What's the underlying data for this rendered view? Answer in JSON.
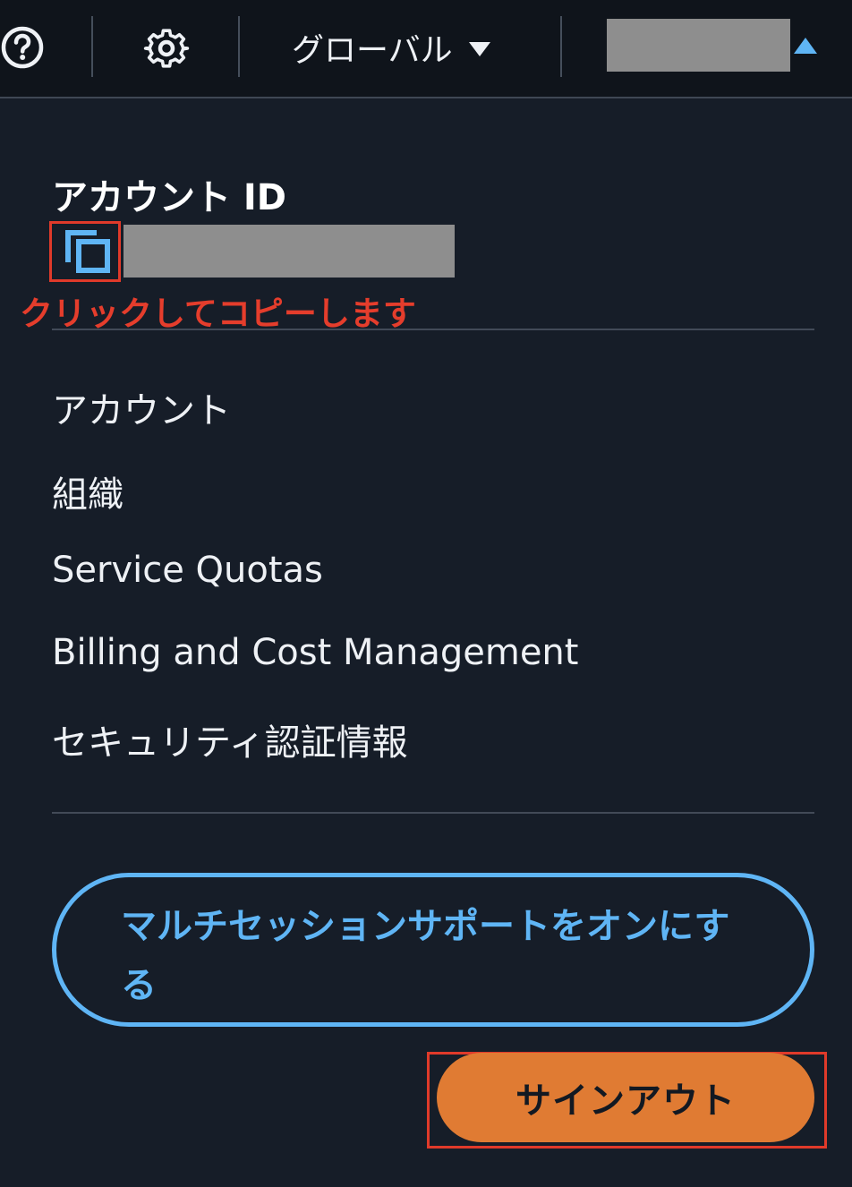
{
  "topbar": {
    "help_icon": "help-circle-icon",
    "settings_icon": "gear-icon",
    "region_label": "グローバル",
    "account_name_redacted": true,
    "account_menu_state": "open"
  },
  "account": {
    "id_label": "アカウント ID",
    "copy_icon": "copy-icon",
    "id_value_redacted": true,
    "copy_annotation": "クリックしてコピーします"
  },
  "menu": {
    "items": [
      {
        "label": "アカウント"
      },
      {
        "label": "組織"
      },
      {
        "label": "Service Quotas"
      },
      {
        "label": "Billing and Cost Management"
      },
      {
        "label": "セキュリティ認証情報"
      }
    ]
  },
  "actions": {
    "multi_session_label": "マルチセッションサポートをオンにする",
    "signout_label": "サインアウト"
  },
  "colors": {
    "background": "#161d28",
    "topbar": "#0f141b",
    "accent_blue": "#5fb5f5",
    "signout_orange": "#e07b33",
    "annotation_red": "#e53d2c"
  }
}
